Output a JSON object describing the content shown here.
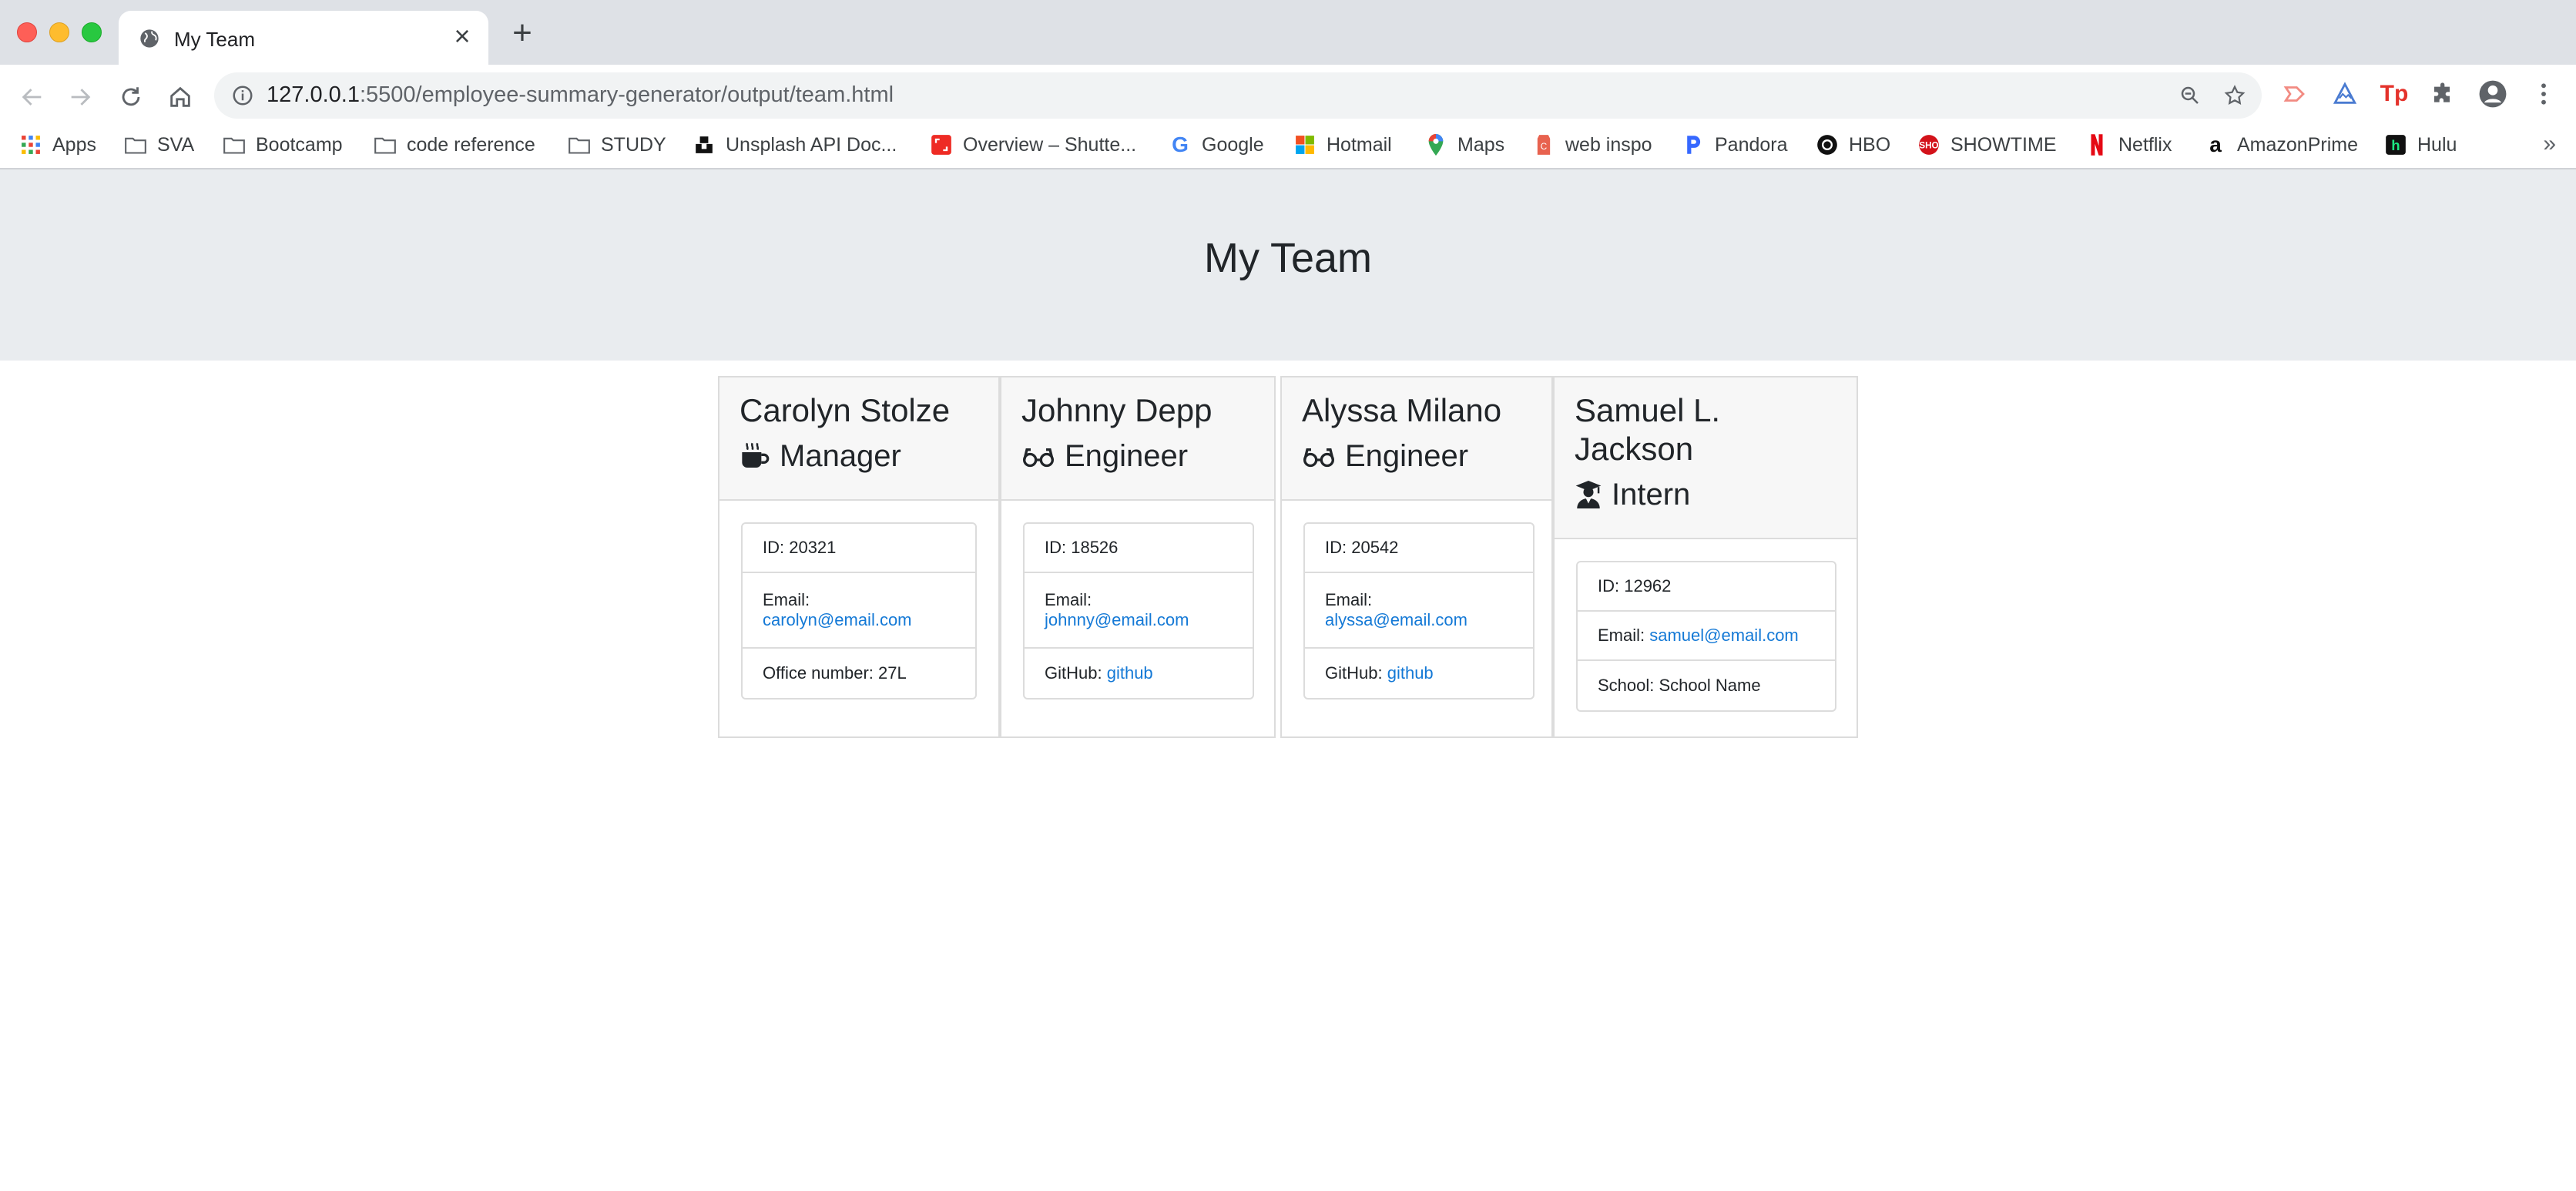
{
  "browser": {
    "tab_title": "My Team",
    "url_host": "127.0.0.1",
    "url_rest": ":5500/employee-summary-generator/output/team.html",
    "bookmarks": [
      {
        "label": "Apps",
        "icon": "apps-grid-icon"
      },
      {
        "label": "SVA",
        "icon": "folder-icon"
      },
      {
        "label": "Bootcamp",
        "icon": "folder-icon"
      },
      {
        "label": "code reference",
        "icon": "folder-icon"
      },
      {
        "label": "STUDY",
        "icon": "folder-icon"
      },
      {
        "label": "Unsplash API Doc...",
        "icon": "unsplash-icon"
      },
      {
        "label": "Overview – Shutte...",
        "icon": "shutterstock-icon"
      },
      {
        "label": "Google",
        "icon": "google-icon"
      },
      {
        "label": "Hotmail",
        "icon": "microsoft-icon"
      },
      {
        "label": "Maps",
        "icon": "maps-pin-icon"
      },
      {
        "label": "web inspo",
        "icon": "web-inspo-icon"
      },
      {
        "label": "Pandora",
        "icon": "pandora-icon"
      },
      {
        "label": "HBO",
        "icon": "hbo-icon"
      },
      {
        "label": "SHOWTIME",
        "icon": "showtime-icon"
      },
      {
        "label": "Netflix",
        "icon": "netflix-icon"
      },
      {
        "label": "AmazonPrime",
        "icon": "amazon-icon"
      },
      {
        "label": "Hulu",
        "icon": "hulu-icon"
      }
    ],
    "overflow_label": "»"
  },
  "page": {
    "title": "My Team"
  },
  "team": [
    {
      "name": "Carolyn Stolze",
      "role": "Manager",
      "role_icon": "mug-icon",
      "id_label": "ID: 20321",
      "email_prefix": "Email:",
      "email": "carolyn@email.com",
      "extra_prefix": "Office number: 27L",
      "extra_link": ""
    },
    {
      "name": "Johnny Depp",
      "role": "Engineer",
      "role_icon": "glasses-icon",
      "id_label": "ID: 18526",
      "email_prefix": "Email:",
      "email": "johnny@email.com",
      "extra_prefix": "GitHub:",
      "extra_link": "github"
    },
    {
      "name": "Alyssa Milano",
      "role": "Engineer",
      "role_icon": "glasses-icon",
      "id_label": "ID: 20542",
      "email_prefix": "Email:",
      "email": "alyssa@email.com",
      "extra_prefix": "GitHub:",
      "extra_link": "github"
    },
    {
      "name_line1": "Samuel L.",
      "name_line2": "Jackson",
      "role": "Intern",
      "role_icon": "graduate-icon",
      "id_label": "ID: 12962",
      "email_prefix": "Email:",
      "email": "samuel@email.com",
      "extra_prefix": "School: School Name",
      "extra_link": ""
    }
  ]
}
